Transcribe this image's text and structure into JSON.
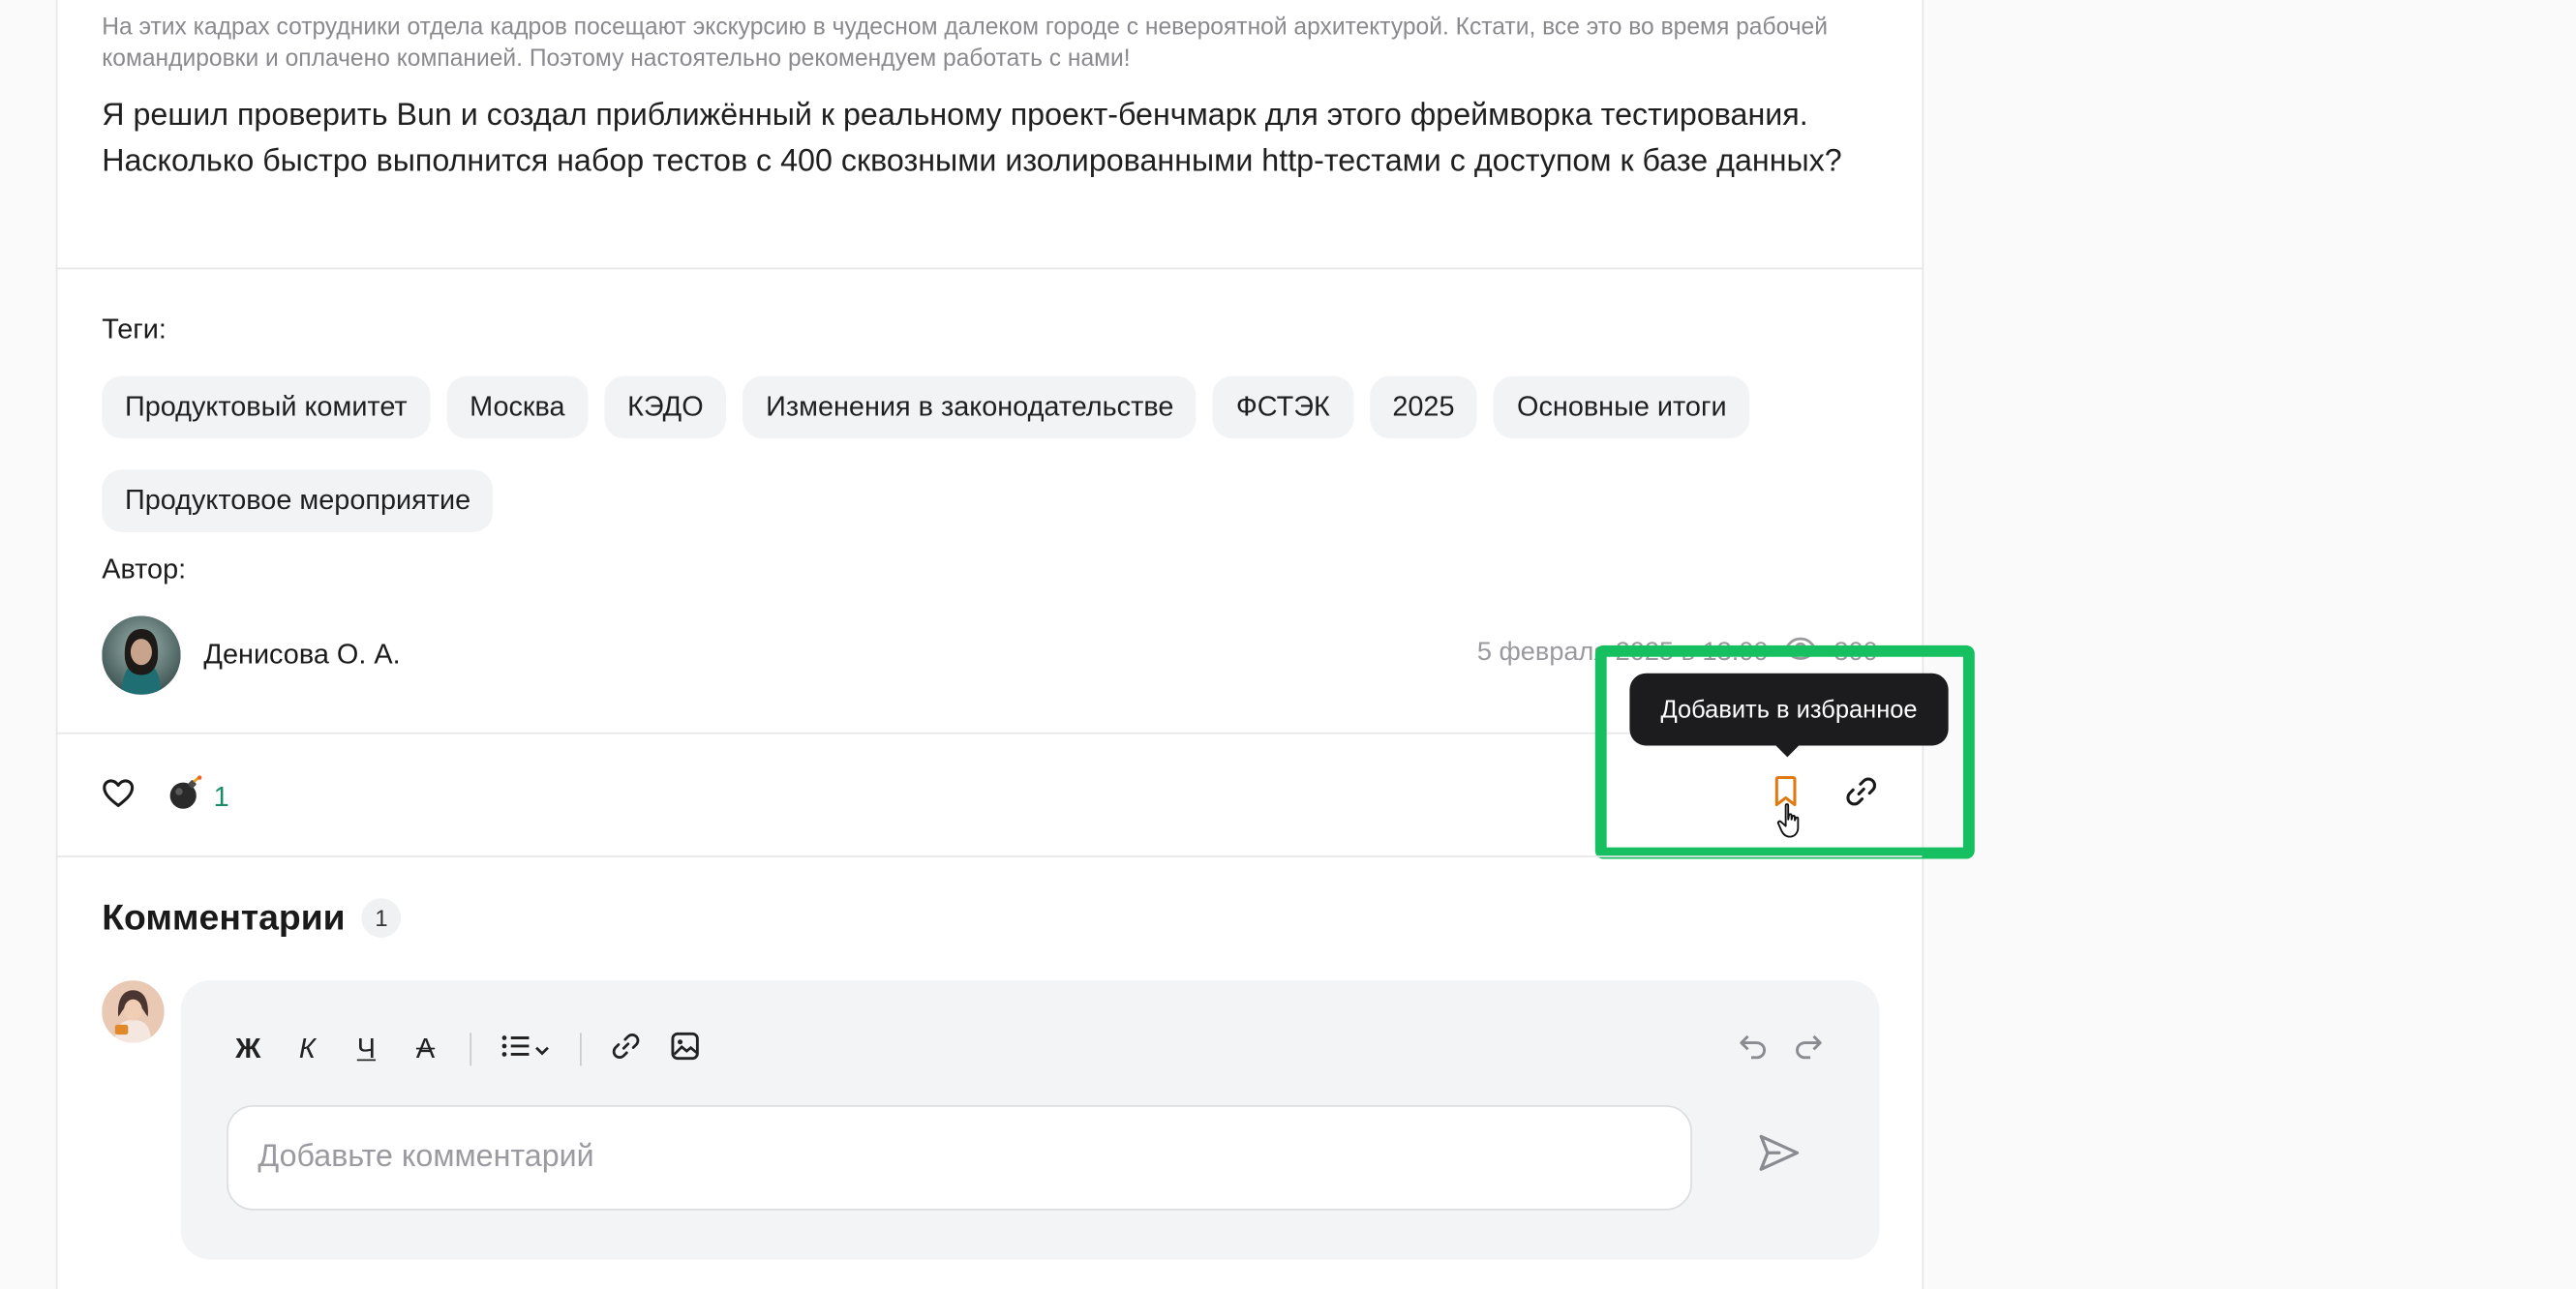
{
  "article": {
    "caption": "На этих кадрах сотрудники отдела кадров посещают экскурсию в чудесном далеком городе с невероятной архитектурой. Кстати, все это во время рабочей командировки и оплачено компанией. Поэтому настоятельно рекомендуем работать с нами!",
    "intro": "Я решил проверить Bun и создал приближённый к реальному проект-бенчмарк для этого фреймворка тестирования. Насколько быстро выполнится набор тестов с 400 сквозными изолированными http-тестами с доступом к базе данных?"
  },
  "tags": {
    "label": "Теги:",
    "items": [
      "Продуктовый комитет",
      "Москва",
      "КЭДО",
      "Изменения в законодательстве",
      "ФСТЭК",
      "2025",
      "Основные итоги",
      "Продуктовое мероприятие"
    ]
  },
  "author": {
    "label": "Автор:",
    "name": "Денисова О. А."
  },
  "meta": {
    "date": "5 февраля 2025 в 13:00",
    "views": "300"
  },
  "reactions": {
    "like_icon": "heart-icon",
    "bomb_icon": "bomb-icon",
    "bomb_count": "1"
  },
  "tooltip": {
    "text": "Добавить в избранное"
  },
  "comments": {
    "title": "Комментарии",
    "count": "1",
    "toolbar": {
      "bold": "Ж",
      "italic": "К",
      "underline": "Ч",
      "strike": "А"
    },
    "input_placeholder": "Добавьте комментарий",
    "input_value": ""
  },
  "colors": {
    "accent_bookmark": "#e07a10",
    "highlight": "#16c060",
    "count_green": "#1a8a6a"
  }
}
